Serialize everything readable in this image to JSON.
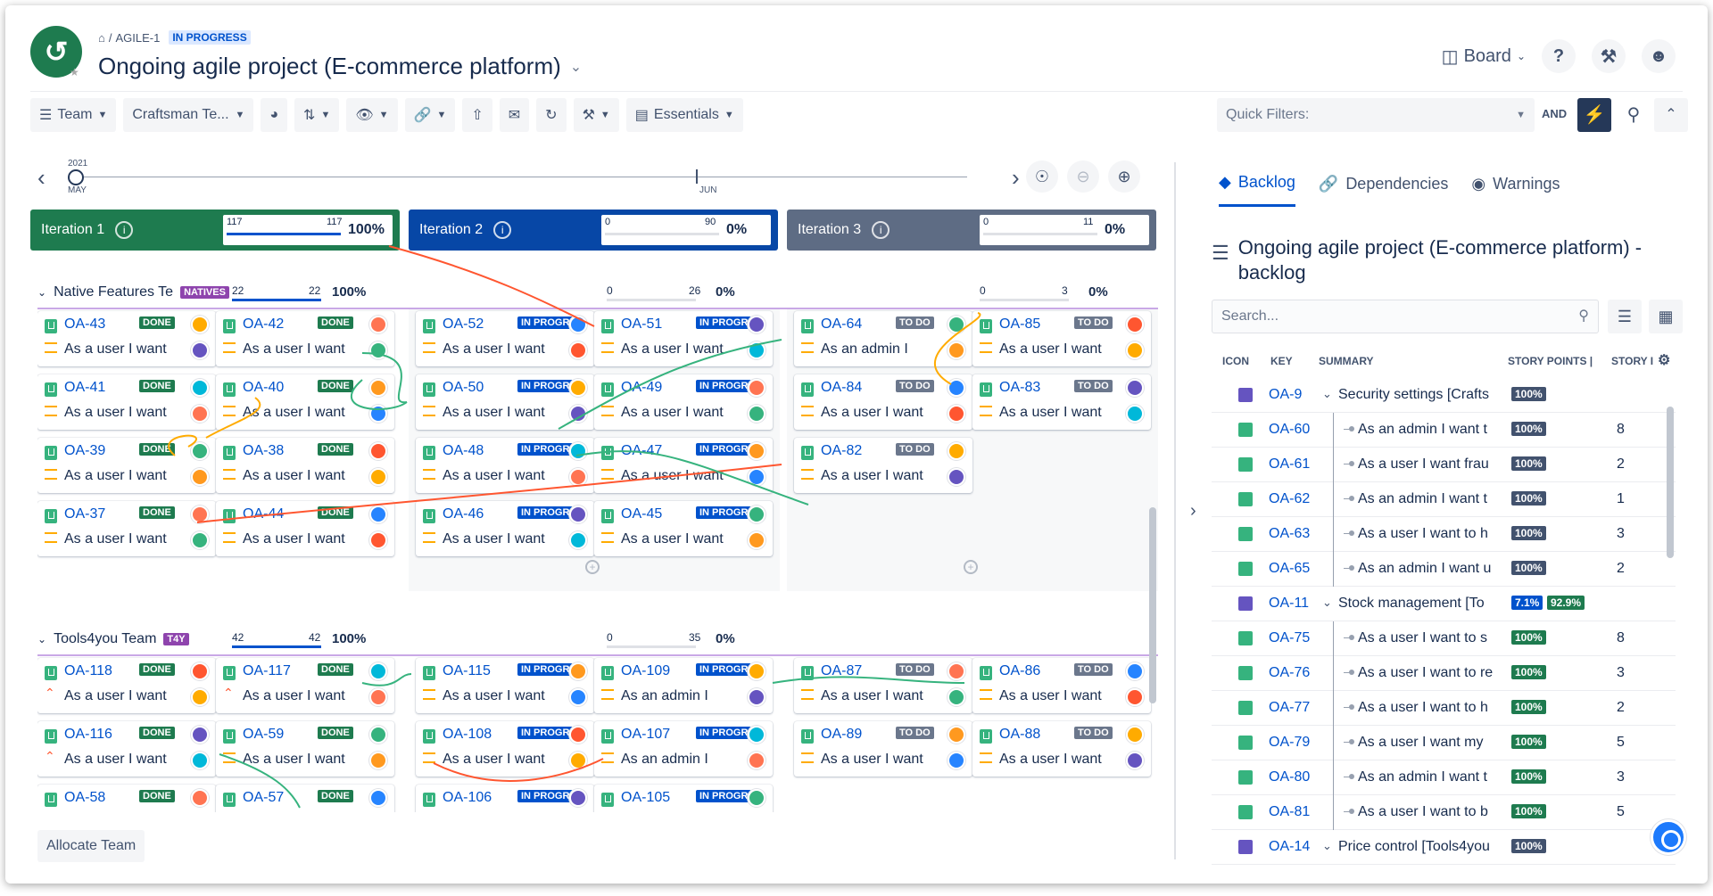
{
  "header": {
    "breadcrumb_project": "AGILE-1",
    "breadcrumb_status": "IN PROGRESS",
    "title": "Ongoing agile project (E-commerce platform)",
    "board_label": "Board"
  },
  "toolbar": {
    "team": "Team",
    "team_select": "Craftsman Te...",
    "essentials": "Essentials",
    "quick_filters_placeholder": "Quick Filters:",
    "and_label": "AND"
  },
  "timeline": {
    "year": "2021",
    "start": "MAY",
    "mid": "JUN"
  },
  "iterations": [
    {
      "name": "Iteration 1",
      "done": "117",
      "total": "117",
      "pct": "100%",
      "color": "#1e7b4f"
    },
    {
      "name": "Iteration 2",
      "done": "0",
      "total": "90",
      "pct": "0%",
      "color": "#0747a6"
    },
    {
      "name": "Iteration 3",
      "done": "0",
      "total": "11",
      "pct": "0%",
      "color": "#5e6c84"
    }
  ],
  "teams": [
    {
      "name": "Native Features Te",
      "tag": "NATIVES",
      "m1": [
        "22",
        "22",
        "100%"
      ],
      "m2": [
        "0",
        "26",
        "0%"
      ],
      "m3": [
        "0",
        "3",
        "0%"
      ]
    },
    {
      "name": "Tools4you Team",
      "tag": "T4Y",
      "m1": [
        "42",
        "42",
        "100%"
      ],
      "m2": [
        "0",
        "35",
        "0%"
      ]
    }
  ],
  "cards": [
    {
      "key": "OA-43",
      "status": "DONE",
      "sum": "As a user I want",
      "col": 0,
      "row": 0,
      "team": 0
    },
    {
      "key": "OA-42",
      "status": "DONE",
      "sum": "As a user I want",
      "col": 1,
      "row": 0,
      "team": 0
    },
    {
      "key": "OA-52",
      "status": "IN PROGR",
      "sum": "As a user I want",
      "col": 2,
      "row": 0,
      "team": 0
    },
    {
      "key": "OA-51",
      "status": "IN PROGR",
      "sum": "As a user I want",
      "col": 3,
      "row": 0,
      "team": 0
    },
    {
      "key": "OA-64",
      "status": "TO DO",
      "sum": "As an admin I",
      "col": 4,
      "row": 0,
      "team": 0
    },
    {
      "key": "OA-85",
      "status": "TO DO",
      "sum": "As a user I want",
      "col": 5,
      "row": 0,
      "team": 0
    },
    {
      "key": "OA-41",
      "status": "DONE",
      "sum": "As a user I want",
      "col": 0,
      "row": 1,
      "team": 0
    },
    {
      "key": "OA-40",
      "status": "DONE",
      "sum": "As a user I want",
      "col": 1,
      "row": 1,
      "team": 0
    },
    {
      "key": "OA-50",
      "status": "IN PROGR",
      "sum": "As a user I want",
      "col": 2,
      "row": 1,
      "team": 0
    },
    {
      "key": "OA-49",
      "status": "IN PROGR",
      "sum": "As a user I want",
      "col": 3,
      "row": 1,
      "team": 0
    },
    {
      "key": "OA-84",
      "status": "TO DO",
      "sum": "As a user I want",
      "col": 4,
      "row": 1,
      "team": 0
    },
    {
      "key": "OA-83",
      "status": "TO DO",
      "sum": "As a user I want",
      "col": 5,
      "row": 1,
      "team": 0
    },
    {
      "key": "OA-39",
      "status": "DONE",
      "sum": "As a user I want",
      "col": 0,
      "row": 2,
      "team": 0
    },
    {
      "key": "OA-38",
      "status": "DONE",
      "sum": "As a user I want",
      "col": 1,
      "row": 2,
      "team": 0
    },
    {
      "key": "OA-48",
      "status": "IN PROGR",
      "sum": "As a user I want",
      "col": 2,
      "row": 2,
      "team": 0
    },
    {
      "key": "OA-47",
      "status": "IN PROGR",
      "sum": "As a user I want",
      "col": 3,
      "row": 2,
      "team": 0
    },
    {
      "key": "OA-82",
      "status": "TO DO",
      "sum": "As a user I want",
      "col": 4,
      "row": 2,
      "team": 0
    },
    {
      "key": "OA-37",
      "status": "DONE",
      "sum": "As a user I want",
      "col": 0,
      "row": 3,
      "team": 0
    },
    {
      "key": "OA-44",
      "status": "DONE",
      "sum": "As a user I want",
      "col": 1,
      "row": 3,
      "team": 0
    },
    {
      "key": "OA-46",
      "status": "IN PROGR",
      "sum": "As a user I want",
      "col": 2,
      "row": 3,
      "team": 0
    },
    {
      "key": "OA-45",
      "status": "IN PROGR",
      "sum": "As a user I want",
      "col": 3,
      "row": 3,
      "team": 0
    },
    {
      "key": "OA-118",
      "status": "DONE",
      "sum": "As a user I want",
      "col": 0,
      "row": 0,
      "team": 1,
      "hi": true
    },
    {
      "key": "OA-117",
      "status": "DONE",
      "sum": "As a user I want",
      "col": 1,
      "row": 0,
      "team": 1,
      "hi": true
    },
    {
      "key": "OA-115",
      "status": "IN PROGR",
      "sum": "As a user I want",
      "col": 2,
      "row": 0,
      "team": 1
    },
    {
      "key": "OA-109",
      "status": "IN PROGR",
      "sum": "As an admin I",
      "col": 3,
      "row": 0,
      "team": 1
    },
    {
      "key": "OA-87",
      "status": "TO DO",
      "sum": "As a user I want",
      "col": 4,
      "row": 0,
      "team": 1
    },
    {
      "key": "OA-86",
      "status": "TO DO",
      "sum": "As a user I want",
      "col": 5,
      "row": 0,
      "team": 1
    },
    {
      "key": "OA-116",
      "status": "DONE",
      "sum": "As a user I want",
      "col": 0,
      "row": 1,
      "team": 1,
      "hi": true
    },
    {
      "key": "OA-59",
      "status": "DONE",
      "sum": "As a user I want",
      "col": 1,
      "row": 1,
      "team": 1
    },
    {
      "key": "OA-108",
      "status": "IN PROGR",
      "sum": "As a user I want",
      "col": 2,
      "row": 1,
      "team": 1
    },
    {
      "key": "OA-107",
      "status": "IN PROGR",
      "sum": "As an admin I",
      "col": 3,
      "row": 1,
      "team": 1
    },
    {
      "key": "OA-89",
      "status": "TO DO",
      "sum": "As a user I want",
      "col": 4,
      "row": 1,
      "team": 1
    },
    {
      "key": "OA-88",
      "status": "TO DO",
      "sum": "As a user I want",
      "col": 5,
      "row": 1,
      "team": 1
    },
    {
      "key": "OA-58",
      "status": "DONE",
      "sum": "",
      "col": 0,
      "row": 2,
      "team": 1
    },
    {
      "key": "OA-57",
      "status": "DONE",
      "sum": "",
      "col": 1,
      "row": 2,
      "team": 1
    },
    {
      "key": "OA-106",
      "status": "IN PROGR",
      "sum": "",
      "col": 2,
      "row": 2,
      "team": 1
    },
    {
      "key": "OA-105",
      "status": "IN PROGR",
      "sum": "",
      "col": 3,
      "row": 2,
      "team": 1
    }
  ],
  "allocate_label": "Allocate Team",
  "right_panel": {
    "tabs": [
      "Backlog",
      "Dependencies",
      "Warnings"
    ],
    "title": "Ongoing agile project (E-commerce platform) - backlog",
    "search_placeholder": "Search...",
    "columns": [
      "ICON",
      "KEY",
      "SUMMARY",
      "STORY POINTS |",
      "STORY I"
    ],
    "rows": [
      {
        "type": "epic",
        "key": "OA-9",
        "sum": "Security settings [Crafts",
        "p1": "100%",
        "p1c": "n",
        "p2": "",
        "sp": "",
        "child": false
      },
      {
        "type": "story",
        "key": "OA-60",
        "sum": "As an admin I want t",
        "p1": "100%",
        "p1c": "n",
        "p2": "",
        "sp": "8",
        "child": true
      },
      {
        "type": "story",
        "key": "OA-61",
        "sum": "As a user I want frau",
        "p1": "100%",
        "p1c": "n",
        "p2": "",
        "sp": "2",
        "child": true
      },
      {
        "type": "story",
        "key": "OA-62",
        "sum": "As an admin I want t",
        "p1": "100%",
        "p1c": "n",
        "p2": "",
        "sp": "1",
        "child": true
      },
      {
        "type": "story",
        "key": "OA-63",
        "sum": "As a user I want to h",
        "p1": "100%",
        "p1c": "n",
        "p2": "",
        "sp": "3",
        "child": true
      },
      {
        "type": "story",
        "key": "OA-65",
        "sum": "As an admin I want u",
        "p1": "100%",
        "p1c": "n",
        "p2": "",
        "sp": "2",
        "child": true
      },
      {
        "type": "epic",
        "key": "OA-11",
        "sum": "Stock management [To",
        "p1": "7.1%",
        "p1c": "b",
        "p2": "92.9%",
        "sp": "",
        "child": false
      },
      {
        "type": "story",
        "key": "OA-75",
        "sum": "As a user I want to s",
        "p1": "100%",
        "p1c": "g",
        "p2": "",
        "sp": "8",
        "child": true
      },
      {
        "type": "story",
        "key": "OA-76",
        "sum": "As a user I want to re",
        "p1": "100%",
        "p1c": "g",
        "p2": "",
        "sp": "3",
        "child": true
      },
      {
        "type": "story",
        "key": "OA-77",
        "sum": "As a user I want to h",
        "p1": "100%",
        "p1c": "g",
        "p2": "",
        "sp": "2",
        "child": true
      },
      {
        "type": "story",
        "key": "OA-79",
        "sum": "As a user I want my",
        "p1": "100%",
        "p1c": "g",
        "p2": "",
        "sp": "5",
        "child": true
      },
      {
        "type": "story",
        "key": "OA-80",
        "sum": "As an admin I want t",
        "p1": "100%",
        "p1c": "g",
        "p2": "",
        "sp": "3",
        "child": true
      },
      {
        "type": "story",
        "key": "OA-81",
        "sum": "As a user I want to b",
        "p1": "100%",
        "p1c": "g",
        "p2": "",
        "sp": "5",
        "child": true
      },
      {
        "type": "epic",
        "key": "OA-14",
        "sum": "Price control [Tools4you",
        "p1": "100%",
        "p1c": "n",
        "p2": "",
        "sp": "",
        "child": false
      }
    ]
  }
}
